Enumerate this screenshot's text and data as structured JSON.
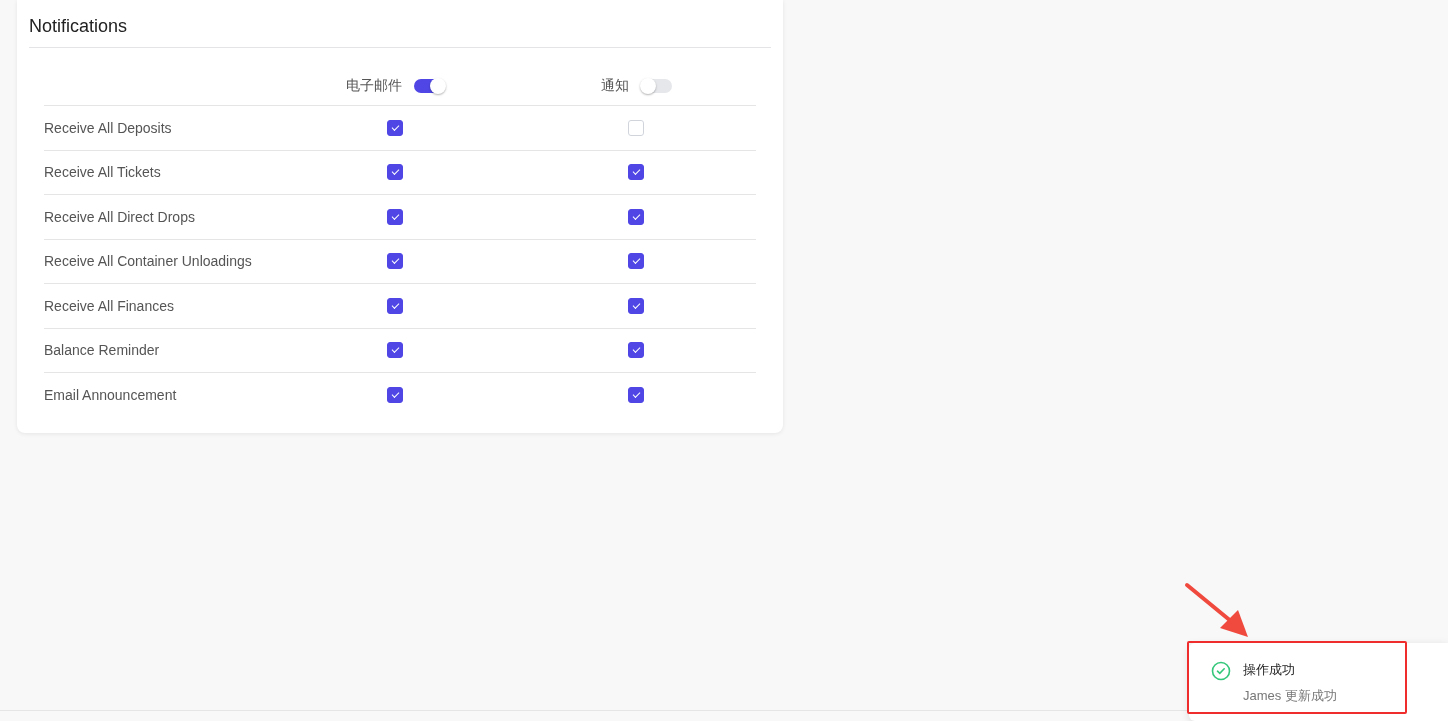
{
  "card": {
    "title": "Notifications"
  },
  "columns": [
    {
      "label": "电子邮件",
      "on": true
    },
    {
      "label": "通知",
      "on": false
    }
  ],
  "rows": [
    {
      "label": "Receive All Deposits",
      "checks": [
        true,
        false
      ]
    },
    {
      "label": "Receive All Tickets",
      "checks": [
        true,
        true
      ]
    },
    {
      "label": "Receive All Direct Drops",
      "checks": [
        true,
        true
      ]
    },
    {
      "label": "Receive All Container Unloadings",
      "checks": [
        true,
        true
      ]
    },
    {
      "label": "Receive All Finances",
      "checks": [
        true,
        true
      ]
    },
    {
      "label": "Balance Reminder",
      "checks": [
        true,
        true
      ]
    },
    {
      "label": "Email Announcement",
      "checks": [
        true,
        true
      ]
    }
  ],
  "toast": {
    "kind": "success",
    "title": "操作成功",
    "message": "James 更新成功"
  }
}
